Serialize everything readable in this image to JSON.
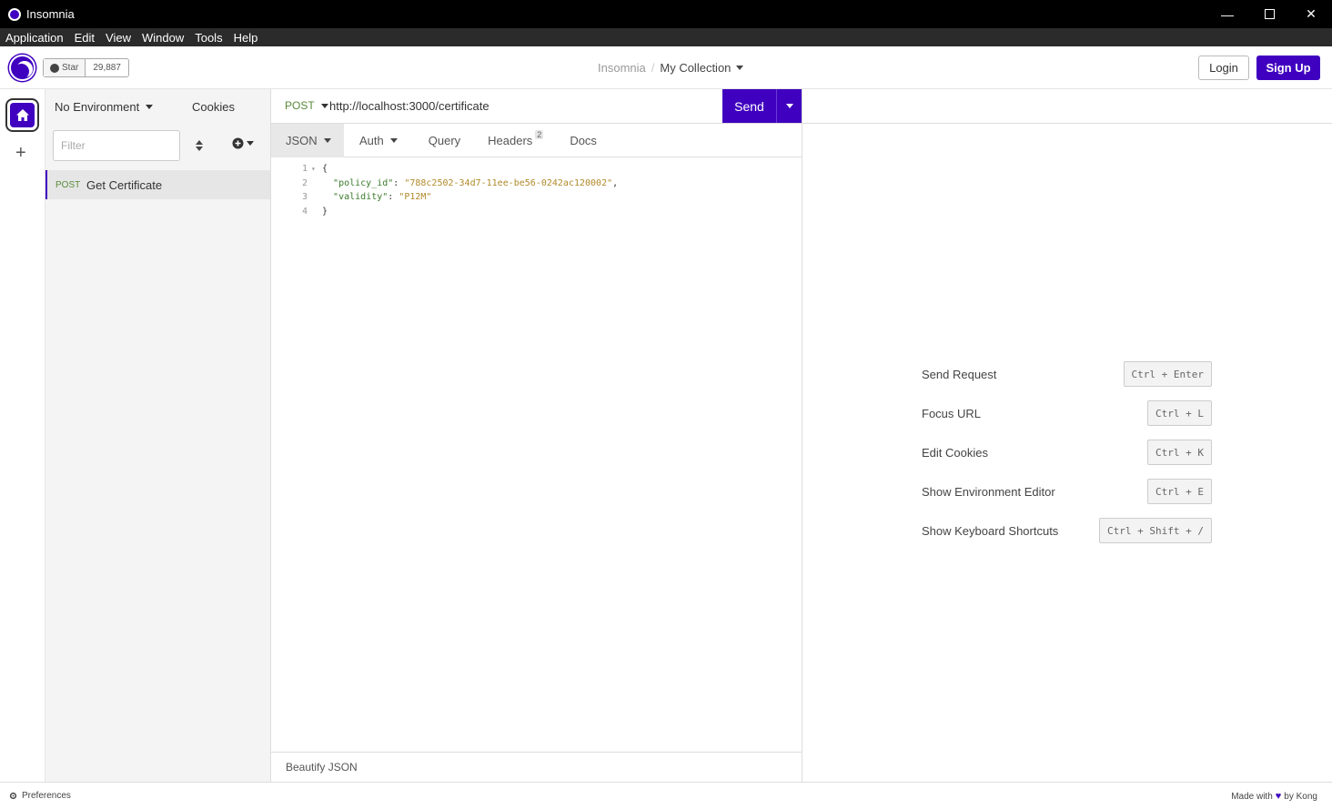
{
  "window": {
    "title": "Insomnia"
  },
  "menu": [
    "Application",
    "Edit",
    "View",
    "Window",
    "Tools",
    "Help"
  ],
  "header": {
    "github": {
      "star_label": "Star",
      "count": "29,887"
    },
    "breadcrumb": {
      "root": "Insomnia",
      "separator": "/",
      "collection": "My Collection"
    },
    "login_label": "Login",
    "signup_label": "Sign Up"
  },
  "sidebar": {
    "environment": "No Environment",
    "cookies_label": "Cookies",
    "filter_placeholder": "Filter",
    "requests": [
      {
        "method": "POST",
        "name": "Get Certificate"
      }
    ]
  },
  "request": {
    "method": "POST",
    "url": "http://localhost:3000/certificate",
    "send_label": "Send",
    "tabs": {
      "json": "JSON",
      "auth": "Auth",
      "query": "Query",
      "headers": "Headers",
      "headers_count": "2",
      "docs": "Docs"
    },
    "body_lines": [
      {
        "num": "1",
        "fold": "▾",
        "text": "{"
      },
      {
        "num": "2",
        "key": "\"policy_id\"",
        "value": "\"788c2502-34d7-11ee-be56-0242ac120002\"",
        "suffix": ","
      },
      {
        "num": "3",
        "key": "\"validity\"",
        "value": "\"P12M\"",
        "suffix": ""
      },
      {
        "num": "4",
        "text": "}"
      }
    ],
    "beautify_label": "Beautify JSON"
  },
  "shortcuts": [
    {
      "label": "Send Request",
      "keys": "Ctrl + Enter"
    },
    {
      "label": "Focus URL",
      "keys": "Ctrl + L"
    },
    {
      "label": "Edit Cookies",
      "keys": "Ctrl + K"
    },
    {
      "label": "Show Environment Editor",
      "keys": "Ctrl + E"
    },
    {
      "label": "Show Keyboard Shortcuts",
      "keys": "Ctrl + Shift + /"
    }
  ],
  "statusbar": {
    "preferences": "Preferences",
    "made_with": "Made with",
    "by": "by Kong"
  },
  "colors": {
    "accent": "#4000bf",
    "method_post": "#5a8a3a"
  }
}
